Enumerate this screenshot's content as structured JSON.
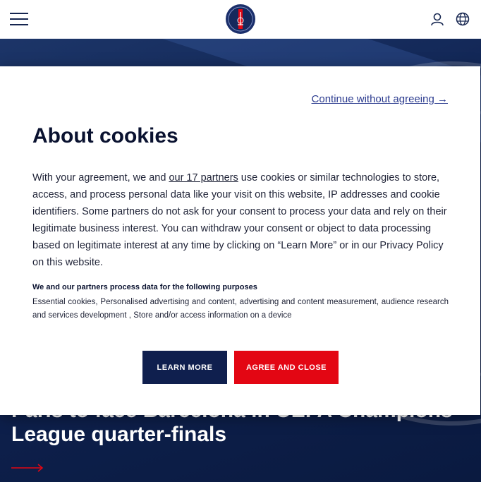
{
  "header": {
    "menu_icon": "hamburger-menu-icon",
    "logo_icon": "psg-crest-logo",
    "account_icon": "user-icon",
    "language_icon": "globe-icon"
  },
  "hero": {
    "headline": "Paris to face Barcelona in UEFA Champions League quarter-finals",
    "arrow_icon": "long-arrow-right-icon"
  },
  "cookie_modal": {
    "continue_without_agreeing": "Continue without agreeing →",
    "title": "About cookies",
    "body_before_link": "With your agreement, we and ",
    "partners_link": "our 17 partners",
    "body_after_link": " use cookies or similar technologies to store, access, and process personal data like your visit on this website, IP addresses and cookie identifiers. Some partners do not ask for your consent to process your data and rely on their legitimate business interest. You can withdraw your consent or object to data processing based on legitimate interest at any time by clicking on “Learn More” or in our Privacy Policy on this website.",
    "purposes_title": "We and our partners process data for the following purposes",
    "purposes_list": "Essential cookies, Personalised advertising and content, advertising and content measurement, audience research and services development , Store and/or access information on a device",
    "learn_more_button": "Learn more",
    "agree_button": "Agree and close"
  },
  "colors": {
    "navy": "#0f1f4e",
    "red": "#e30613",
    "link": "#2b3b8f"
  }
}
